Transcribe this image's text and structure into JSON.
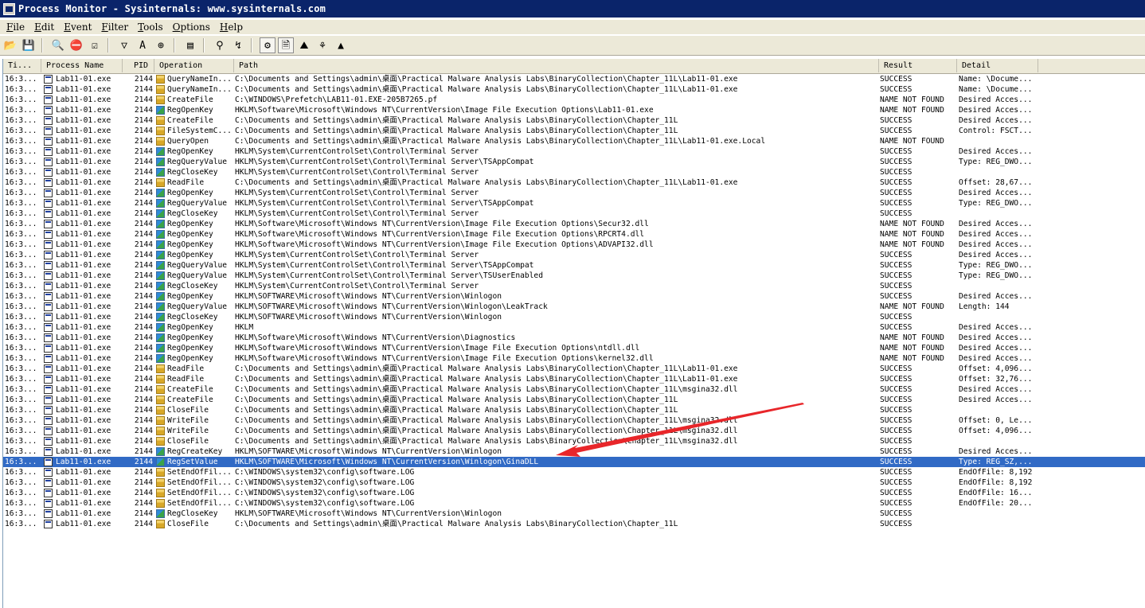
{
  "window": {
    "title": "Process Monitor - Sysinternals: www.sysinternals.com"
  },
  "menu": [
    {
      "label": "File",
      "key": "F",
      "rest": "ile"
    },
    {
      "label": "Edit",
      "key": "E",
      "rest": "dit"
    },
    {
      "label": "Event",
      "key": "E",
      "rest": "vent"
    },
    {
      "label": "Filter",
      "key": "F",
      "rest": "ilter"
    },
    {
      "label": "Tools",
      "key": "T",
      "rest": "ools"
    },
    {
      "label": "Options",
      "key": "O",
      "rest": "ptions"
    },
    {
      "label": "Help",
      "key": "H",
      "rest": "elp"
    }
  ],
  "toolbar": {
    "buttons": [
      {
        "name": "open-icon",
        "glyph": "📂"
      },
      {
        "name": "save-icon",
        "glyph": "💾"
      },
      {
        "sep": true
      },
      {
        "name": "magnify-icon",
        "glyph": "🔍"
      },
      {
        "name": "capture-icon",
        "glyph": "⛔"
      },
      {
        "name": "autoscroll-icon",
        "glyph": "☑"
      },
      {
        "sep": true
      },
      {
        "name": "filter-icon",
        "glyph": "▽"
      },
      {
        "name": "highlight-icon",
        "glyph": "A"
      },
      {
        "name": "target-icon",
        "glyph": "⊕"
      },
      {
        "sep": true
      },
      {
        "name": "properties-icon",
        "glyph": "▤"
      },
      {
        "sep": true
      },
      {
        "name": "find-icon",
        "glyph": "⚲"
      },
      {
        "name": "jump-icon",
        "glyph": "↯"
      },
      {
        "sep": true
      },
      {
        "name": "show-registry-icon",
        "glyph": "⚙",
        "pressed": true
      },
      {
        "name": "show-filesystem-icon",
        "glyph": "🗎",
        "pressed": true
      },
      {
        "name": "show-network-icon",
        "glyph": "⛰"
      },
      {
        "name": "show-process-icon",
        "glyph": "⚘"
      },
      {
        "name": "show-profiling-icon",
        "glyph": "▲"
      }
    ]
  },
  "columns": {
    "time": "Ti...",
    "process": "Process Name",
    "pid": "PID",
    "operation": "Operation",
    "path": "Path",
    "result": "Result",
    "detail": "Detail"
  },
  "rows": [
    {
      "time": "16:3...",
      "process": "Lab11-01.exe",
      "pid": "2144",
      "icon": "file",
      "op": "QueryNameIn...",
      "path": "C:\\Documents and Settings\\admin\\桌面\\Practical Malware Analysis Labs\\BinaryCollection\\Chapter_11L\\Lab11-01.exe",
      "result": "SUCCESS",
      "detail": "Name: \\Docume..."
    },
    {
      "time": "16:3...",
      "process": "Lab11-01.exe",
      "pid": "2144",
      "icon": "file",
      "op": "QueryNameIn...",
      "path": "C:\\Documents and Settings\\admin\\桌面\\Practical Malware Analysis Labs\\BinaryCollection\\Chapter_11L\\Lab11-01.exe",
      "result": "SUCCESS",
      "detail": "Name: \\Docume..."
    },
    {
      "time": "16:3...",
      "process": "Lab11-01.exe",
      "pid": "2144",
      "icon": "file",
      "op": "CreateFile",
      "path": "C:\\WINDOWS\\Prefetch\\LAB11-01.EXE-205B7265.pf",
      "result": "NAME NOT FOUND",
      "detail": "Desired Acces..."
    },
    {
      "time": "16:3...",
      "process": "Lab11-01.exe",
      "pid": "2144",
      "icon": "reg",
      "op": "RegOpenKey",
      "path": "HKLM\\Software\\Microsoft\\Windows NT\\CurrentVersion\\Image File Execution Options\\Lab11-01.exe",
      "result": "NAME NOT FOUND",
      "detail": "Desired Acces..."
    },
    {
      "time": "16:3...",
      "process": "Lab11-01.exe",
      "pid": "2144",
      "icon": "file",
      "op": "CreateFile",
      "path": "C:\\Documents and Settings\\admin\\桌面\\Practical Malware Analysis Labs\\BinaryCollection\\Chapter_11L",
      "result": "SUCCESS",
      "detail": "Desired Acces..."
    },
    {
      "time": "16:3...",
      "process": "Lab11-01.exe",
      "pid": "2144",
      "icon": "file",
      "op": "FileSystemC...",
      "path": "C:\\Documents and Settings\\admin\\桌面\\Practical Malware Analysis Labs\\BinaryCollection\\Chapter_11L",
      "result": "SUCCESS",
      "detail": "Control: FSCT..."
    },
    {
      "time": "16:3...",
      "process": "Lab11-01.exe",
      "pid": "2144",
      "icon": "file",
      "op": "QueryOpen",
      "path": "C:\\Documents and Settings\\admin\\桌面\\Practical Malware Analysis Labs\\BinaryCollection\\Chapter_11L\\Lab11-01.exe.Local",
      "result": "NAME NOT FOUND",
      "detail": ""
    },
    {
      "time": "16:3...",
      "process": "Lab11-01.exe",
      "pid": "2144",
      "icon": "reg",
      "op": "RegOpenKey",
      "path": "HKLM\\System\\CurrentControlSet\\Control\\Terminal Server",
      "result": "SUCCESS",
      "detail": "Desired Acces..."
    },
    {
      "time": "16:3...",
      "process": "Lab11-01.exe",
      "pid": "2144",
      "icon": "reg",
      "op": "RegQueryValue",
      "path": "HKLM\\System\\CurrentControlSet\\Control\\Terminal Server\\TSAppCompat",
      "result": "SUCCESS",
      "detail": "Type: REG_DWO..."
    },
    {
      "time": "16:3...",
      "process": "Lab11-01.exe",
      "pid": "2144",
      "icon": "reg",
      "op": "RegCloseKey",
      "path": "HKLM\\System\\CurrentControlSet\\Control\\Terminal Server",
      "result": "SUCCESS",
      "detail": ""
    },
    {
      "time": "16:3...",
      "process": "Lab11-01.exe",
      "pid": "2144",
      "icon": "file",
      "op": "ReadFile",
      "path": "C:\\Documents and Settings\\admin\\桌面\\Practical Malware Analysis Labs\\BinaryCollection\\Chapter_11L\\Lab11-01.exe",
      "result": "SUCCESS",
      "detail": "Offset: 28,67..."
    },
    {
      "time": "16:3...",
      "process": "Lab11-01.exe",
      "pid": "2144",
      "icon": "reg",
      "op": "RegOpenKey",
      "path": "HKLM\\System\\CurrentControlSet\\Control\\Terminal Server",
      "result": "SUCCESS",
      "detail": "Desired Acces..."
    },
    {
      "time": "16:3...",
      "process": "Lab11-01.exe",
      "pid": "2144",
      "icon": "reg",
      "op": "RegQueryValue",
      "path": "HKLM\\System\\CurrentControlSet\\Control\\Terminal Server\\TSAppCompat",
      "result": "SUCCESS",
      "detail": "Type: REG_DWO..."
    },
    {
      "time": "16:3...",
      "process": "Lab11-01.exe",
      "pid": "2144",
      "icon": "reg",
      "op": "RegCloseKey",
      "path": "HKLM\\System\\CurrentControlSet\\Control\\Terminal Server",
      "result": "SUCCESS",
      "detail": ""
    },
    {
      "time": "16:3...",
      "process": "Lab11-01.exe",
      "pid": "2144",
      "icon": "reg",
      "op": "RegOpenKey",
      "path": "HKLM\\Software\\Microsoft\\Windows NT\\CurrentVersion\\Image File Execution Options\\Secur32.dll",
      "result": "NAME NOT FOUND",
      "detail": "Desired Acces..."
    },
    {
      "time": "16:3...",
      "process": "Lab11-01.exe",
      "pid": "2144",
      "icon": "reg",
      "op": "RegOpenKey",
      "path": "HKLM\\Software\\Microsoft\\Windows NT\\CurrentVersion\\Image File Execution Options\\RPCRT4.dll",
      "result": "NAME NOT FOUND",
      "detail": "Desired Acces..."
    },
    {
      "time": "16:3...",
      "process": "Lab11-01.exe",
      "pid": "2144",
      "icon": "reg",
      "op": "RegOpenKey",
      "path": "HKLM\\Software\\Microsoft\\Windows NT\\CurrentVersion\\Image File Execution Options\\ADVAPI32.dll",
      "result": "NAME NOT FOUND",
      "detail": "Desired Acces..."
    },
    {
      "time": "16:3...",
      "process": "Lab11-01.exe",
      "pid": "2144",
      "icon": "reg",
      "op": "RegOpenKey",
      "path": "HKLM\\System\\CurrentControlSet\\Control\\Terminal Server",
      "result": "SUCCESS",
      "detail": "Desired Acces..."
    },
    {
      "time": "16:3...",
      "process": "Lab11-01.exe",
      "pid": "2144",
      "icon": "reg",
      "op": "RegQueryValue",
      "path": "HKLM\\System\\CurrentControlSet\\Control\\Terminal Server\\TSAppCompat",
      "result": "SUCCESS",
      "detail": "Type: REG_DWO..."
    },
    {
      "time": "16:3...",
      "process": "Lab11-01.exe",
      "pid": "2144",
      "icon": "reg",
      "op": "RegQueryValue",
      "path": "HKLM\\System\\CurrentControlSet\\Control\\Terminal Server\\TSUserEnabled",
      "result": "SUCCESS",
      "detail": "Type: REG_DWO..."
    },
    {
      "time": "16:3...",
      "process": "Lab11-01.exe",
      "pid": "2144",
      "icon": "reg",
      "op": "RegCloseKey",
      "path": "HKLM\\System\\CurrentControlSet\\Control\\Terminal Server",
      "result": "SUCCESS",
      "detail": ""
    },
    {
      "time": "16:3...",
      "process": "Lab11-01.exe",
      "pid": "2144",
      "icon": "reg",
      "op": "RegOpenKey",
      "path": "HKLM\\SOFTWARE\\Microsoft\\Windows NT\\CurrentVersion\\Winlogon",
      "result": "SUCCESS",
      "detail": "Desired Acces..."
    },
    {
      "time": "16:3...",
      "process": "Lab11-01.exe",
      "pid": "2144",
      "icon": "reg",
      "op": "RegQueryValue",
      "path": "HKLM\\SOFTWARE\\Microsoft\\Windows NT\\CurrentVersion\\Winlogon\\LeakTrack",
      "result": "NAME NOT FOUND",
      "detail": "Length: 144"
    },
    {
      "time": "16:3...",
      "process": "Lab11-01.exe",
      "pid": "2144",
      "icon": "reg",
      "op": "RegCloseKey",
      "path": "HKLM\\SOFTWARE\\Microsoft\\Windows NT\\CurrentVersion\\Winlogon",
      "result": "SUCCESS",
      "detail": ""
    },
    {
      "time": "16:3...",
      "process": "Lab11-01.exe",
      "pid": "2144",
      "icon": "reg",
      "op": "RegOpenKey",
      "path": "HKLM",
      "result": "SUCCESS",
      "detail": "Desired Acces..."
    },
    {
      "time": "16:3...",
      "process": "Lab11-01.exe",
      "pid": "2144",
      "icon": "reg",
      "op": "RegOpenKey",
      "path": "HKLM\\Software\\Microsoft\\Windows NT\\CurrentVersion\\Diagnostics",
      "result": "NAME NOT FOUND",
      "detail": "Desired Acces..."
    },
    {
      "time": "16:3...",
      "process": "Lab11-01.exe",
      "pid": "2144",
      "icon": "reg",
      "op": "RegOpenKey",
      "path": "HKLM\\Software\\Microsoft\\Windows NT\\CurrentVersion\\Image File Execution Options\\ntdll.dll",
      "result": "NAME NOT FOUND",
      "detail": "Desired Acces..."
    },
    {
      "time": "16:3...",
      "process": "Lab11-01.exe",
      "pid": "2144",
      "icon": "reg",
      "op": "RegOpenKey",
      "path": "HKLM\\Software\\Microsoft\\Windows NT\\CurrentVersion\\Image File Execution Options\\kernel32.dll",
      "result": "NAME NOT FOUND",
      "detail": "Desired Acces..."
    },
    {
      "time": "16:3...",
      "process": "Lab11-01.exe",
      "pid": "2144",
      "icon": "file",
      "op": "ReadFile",
      "path": "C:\\Documents and Settings\\admin\\桌面\\Practical Malware Analysis Labs\\BinaryCollection\\Chapter_11L\\Lab11-01.exe",
      "result": "SUCCESS",
      "detail": "Offset: 4,096..."
    },
    {
      "time": "16:3...",
      "process": "Lab11-01.exe",
      "pid": "2144",
      "icon": "file",
      "op": "ReadFile",
      "path": "C:\\Documents and Settings\\admin\\桌面\\Practical Malware Analysis Labs\\BinaryCollection\\Chapter_11L\\Lab11-01.exe",
      "result": "SUCCESS",
      "detail": "Offset: 32,76..."
    },
    {
      "time": "16:3...",
      "process": "Lab11-01.exe",
      "pid": "2144",
      "icon": "file",
      "op": "CreateFile",
      "path": "C:\\Documents and Settings\\admin\\桌面\\Practical Malware Analysis Labs\\BinaryCollection\\Chapter_11L\\msgina32.dll",
      "result": "SUCCESS",
      "detail": "Desired Acces..."
    },
    {
      "time": "16:3...",
      "process": "Lab11-01.exe",
      "pid": "2144",
      "icon": "file",
      "op": "CreateFile",
      "path": "C:\\Documents and Settings\\admin\\桌面\\Practical Malware Analysis Labs\\BinaryCollection\\Chapter_11L",
      "result": "SUCCESS",
      "detail": "Desired Acces..."
    },
    {
      "time": "16:3...",
      "process": "Lab11-01.exe",
      "pid": "2144",
      "icon": "file",
      "op": "CloseFile",
      "path": "C:\\Documents and Settings\\admin\\桌面\\Practical Malware Analysis Labs\\BinaryCollection\\Chapter_11L",
      "result": "SUCCESS",
      "detail": ""
    },
    {
      "time": "16:3...",
      "process": "Lab11-01.exe",
      "pid": "2144",
      "icon": "file",
      "op": "WriteFile",
      "path": "C:\\Documents and Settings\\admin\\桌面\\Practical Malware Analysis Labs\\BinaryCollection\\Chapter_11L\\msgina32.dll",
      "result": "SUCCESS",
      "detail": "Offset: 0, Le..."
    },
    {
      "time": "16:3...",
      "process": "Lab11-01.exe",
      "pid": "2144",
      "icon": "file",
      "op": "WriteFile",
      "path": "C:\\Documents and Settings\\admin\\桌面\\Practical Malware Analysis Labs\\BinaryCollection\\Chapter_11L\\msgina32.dll",
      "result": "SUCCESS",
      "detail": "Offset: 4,096..."
    },
    {
      "time": "16:3...",
      "process": "Lab11-01.exe",
      "pid": "2144",
      "icon": "file",
      "op": "CloseFile",
      "path": "C:\\Documents and Settings\\admin\\桌面\\Practical Malware Analysis Labs\\BinaryCollection\\Chapter_11L\\msgina32.dll",
      "result": "SUCCESS",
      "detail": ""
    },
    {
      "time": "16:3...",
      "process": "Lab11-01.exe",
      "pid": "2144",
      "icon": "reg",
      "op": "RegCreateKey",
      "path": "HKLM\\SOFTWARE\\Microsoft\\Windows NT\\CurrentVersion\\Winlogon",
      "result": "SUCCESS",
      "detail": "Desired Acces..."
    },
    {
      "time": "16:3...",
      "process": "Lab11-01.exe",
      "pid": "2144",
      "icon": "reg",
      "op": "RegSetValue",
      "path": "HKLM\\SOFTWARE\\Microsoft\\Windows NT\\CurrentVersion\\Winlogon\\GinaDLL",
      "result": "SUCCESS",
      "detail": "Type: REG_SZ,...",
      "selected": true
    },
    {
      "time": "16:3...",
      "process": "Lab11-01.exe",
      "pid": "2144",
      "icon": "file",
      "op": "SetEndOfFil...",
      "path": "C:\\WINDOWS\\system32\\config\\software.LOG",
      "result": "SUCCESS",
      "detail": "EndOfFile: 8,192"
    },
    {
      "time": "16:3...",
      "process": "Lab11-01.exe",
      "pid": "2144",
      "icon": "file",
      "op": "SetEndOfFil...",
      "path": "C:\\WINDOWS\\system32\\config\\software.LOG",
      "result": "SUCCESS",
      "detail": "EndOfFile: 8,192"
    },
    {
      "time": "16:3...",
      "process": "Lab11-01.exe",
      "pid": "2144",
      "icon": "file",
      "op": "SetEndOfFil...",
      "path": "C:\\WINDOWS\\system32\\config\\software.LOG",
      "result": "SUCCESS",
      "detail": "EndOfFile: 16..."
    },
    {
      "time": "16:3...",
      "process": "Lab11-01.exe",
      "pid": "2144",
      "icon": "file",
      "op": "SetEndOfFil...",
      "path": "C:\\WINDOWS\\system32\\config\\software.LOG",
      "result": "SUCCESS",
      "detail": "EndOfFile: 20..."
    },
    {
      "time": "16:3...",
      "process": "Lab11-01.exe",
      "pid": "2144",
      "icon": "reg",
      "op": "RegCloseKey",
      "path": "HKLM\\SOFTWARE\\Microsoft\\Windows NT\\CurrentVersion\\Winlogon",
      "result": "SUCCESS",
      "detail": ""
    },
    {
      "time": "16:3...",
      "process": "Lab11-01.exe",
      "pid": "2144",
      "icon": "file",
      "op": "CloseFile",
      "path": "C:\\Documents and Settings\\admin\\桌面\\Practical Malware Analysis Labs\\BinaryCollection\\Chapter_11L",
      "result": "SUCCESS",
      "detail": ""
    }
  ],
  "colors": {
    "selection": "#316ac5",
    "title_bar": "#0a246a",
    "annotation_arrow": "#e8262a"
  }
}
